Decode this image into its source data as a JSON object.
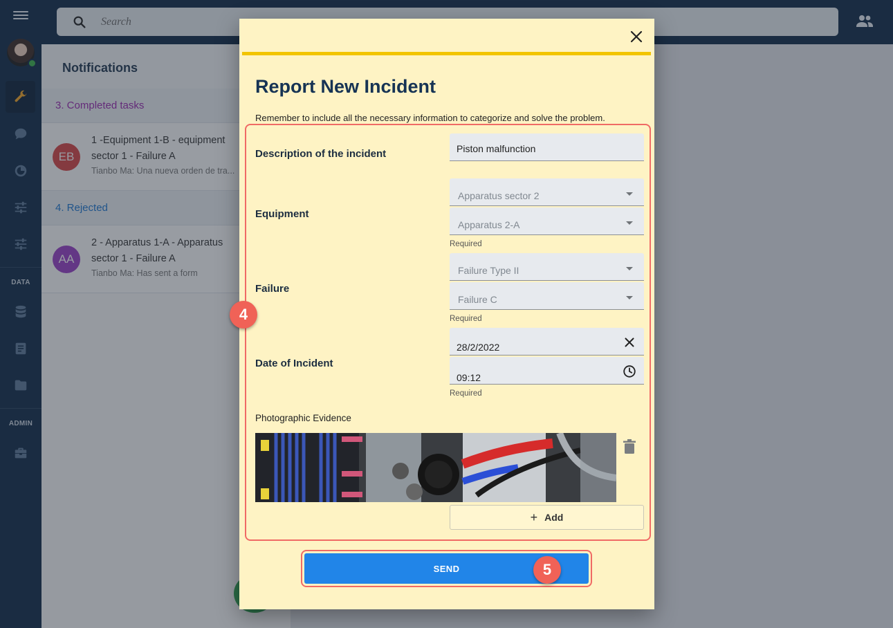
{
  "search": {
    "placeholder": "Search"
  },
  "sidebar": {
    "section_data": "DATA",
    "section_admin": "ADMIN"
  },
  "notifications": {
    "title": "Notifications",
    "sections": [
      {
        "label": "3. Completed tasks",
        "items": [
          {
            "initials": "EB",
            "avatar_color": "#d84343",
            "title": "1 -Equipment 1-B - equipment sector 1 - Failure A",
            "subtitle": "Tianbo Ma: Una nueva orden de tra..."
          }
        ]
      },
      {
        "label": "4. Rejected",
        "items": [
          {
            "initials": "AA",
            "avatar_color": "#9a3fc8",
            "title": "2 - Apparatus 1-A - Apparatus sector 1 - Failure A",
            "subtitle": "Tianbo Ma: Has sent a form"
          }
        ]
      }
    ]
  },
  "dialog": {
    "title": "Report New Incident",
    "subtitle": "Remember to include all the necessary information to categorize and solve the problem.",
    "description": {
      "label": "Description of the incident",
      "value": "Piston malfunction"
    },
    "equipment": {
      "label": "Equipment",
      "select1": "Apparatus sector 2",
      "select2": "Apparatus 2-A",
      "required": "Required"
    },
    "failure": {
      "label": "Failure",
      "select1": "Failure Type II",
      "select2": "Failure C",
      "required": "Required"
    },
    "date": {
      "label": "Date of Incident",
      "date_value": "28/2/2022",
      "time_value": "09:12",
      "required": "Required"
    },
    "photo": {
      "label": "Photographic Evidence"
    },
    "add_label": "Add",
    "send_label": "SEND"
  },
  "annotations": {
    "badge_form": "4",
    "badge_send": "5"
  },
  "colors": {
    "accent_blue": "#2185e8",
    "dialog_bg": "#fef3c4",
    "highlight": "#f06a65",
    "rule_yellow": "#f2c400",
    "nav_bg": "#0e2a48"
  },
  "icons": [
    "menu-icon",
    "wrench-icon",
    "chat-icon",
    "timer-icon",
    "sliders-icon",
    "database-icon",
    "document-icon",
    "folder-icon",
    "toolbox-icon",
    "search-icon",
    "people-icon",
    "close-icon",
    "clock-icon",
    "trash-icon"
  ]
}
